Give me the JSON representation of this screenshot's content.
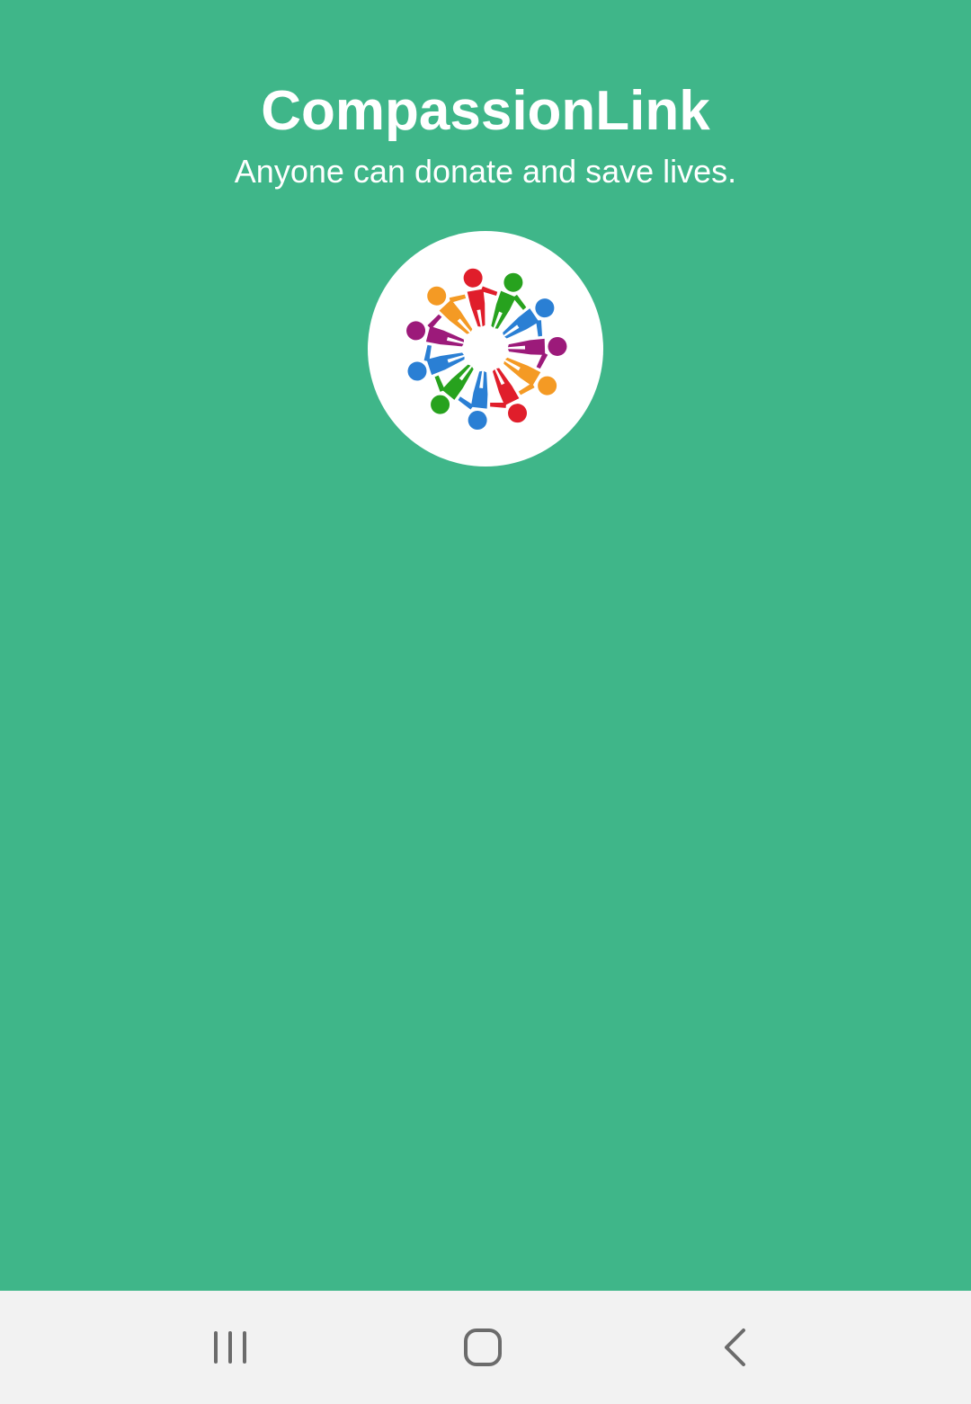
{
  "app": {
    "title": "CompassionLink",
    "subtitle": "Anyone can donate and save lives.",
    "logo": {
      "icon": "people-circle-logo-icon",
      "figure_colors": [
        "#e01e2b",
        "#27a21e",
        "#2a7fd4",
        "#9c1a7a",
        "#f49a24",
        "#e01e2b",
        "#2a7fd4",
        "#27a21e",
        "#2a7fd4",
        "#9c1a7a",
        "#f49a24"
      ]
    },
    "background_color": "#3fb689"
  },
  "navbar": {
    "recents_icon": "recents-icon",
    "home_icon": "home-icon",
    "back_icon": "back-icon"
  }
}
